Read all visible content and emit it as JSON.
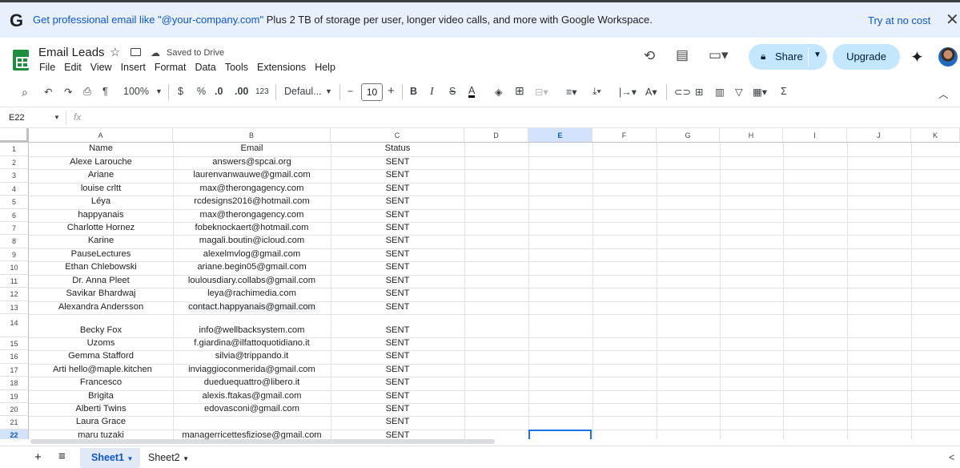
{
  "banner": {
    "logo": "G",
    "headline": "Get professional email like \"@your-company.com\"",
    "rest": " Plus 2 TB of storage per user, longer video calls, and more with Google Workspace.",
    "cta": "Try at no cost",
    "close": "✕"
  },
  "doc": {
    "title": "Email Leads",
    "saved": "Saved to Drive"
  },
  "menu": [
    "File",
    "Edit",
    "View",
    "Insert",
    "Format",
    "Data",
    "Tools",
    "Extensions",
    "Help"
  ],
  "header": {
    "share": "Share",
    "upgrade": "Upgrade"
  },
  "toolbar": {
    "zoom": "100%",
    "currency": "$",
    "percent": "%",
    "dec_dec": ".0",
    "dec_inc": ".00",
    "numfmt": "123",
    "font": "Defaul...",
    "font_size": "10",
    "bold": "B",
    "italic": "I",
    "strike": "S",
    "text_color": "A",
    "minus": "−",
    "plus": "+"
  },
  "formula": {
    "cell_ref": "E22",
    "fx": "fx",
    "value": ""
  },
  "columns": [
    "A",
    "B",
    "C",
    "D",
    "E",
    "F",
    "G",
    "H",
    "I",
    "J",
    "K"
  ],
  "selected_cell": "E22",
  "rows": [
    {
      "n": "1",
      "name": "Name",
      "email": "Email",
      "status": "Status"
    },
    {
      "n": "2",
      "name": "Alexe Larouche",
      "email": "answers@spcai.org",
      "status": "SENT"
    },
    {
      "n": "3",
      "name": "Ariane",
      "email": "laurenvanwauwe@gmail.com",
      "status": "SENT"
    },
    {
      "n": "4",
      "name": "louise crltt",
      "email": "max@therongagency.com",
      "status": "SENT"
    },
    {
      "n": "5",
      "name": "Léya",
      "email": "rcdesigns2016@hotmail.com",
      "status": "SENT"
    },
    {
      "n": "6",
      "name": "happyanais",
      "email": "max@therongagency.com",
      "status": "SENT"
    },
    {
      "n": "7",
      "name": "Charlotte Hornez",
      "email": "fobeknockaert@hotmail.com",
      "status": "SENT"
    },
    {
      "n": "8",
      "name": "Karine",
      "email": "magali.boutin@icloud.com",
      "status": "SENT"
    },
    {
      "n": "9",
      "name": "PauseLectures",
      "email": "alexelmvlog@gmail.com",
      "status": "SENT"
    },
    {
      "n": "10",
      "name": "Ethan Chlebowski",
      "email": "ariane.begin05@gmail.com",
      "status": "SENT"
    },
    {
      "n": "11",
      "name": "Dr. Anna Pleet",
      "email": "loulousdiary.collabs@gmail.com",
      "status": "SENT"
    },
    {
      "n": "12",
      "name": "Savikar Bhardwaj",
      "email": "leya@rachimedia.com",
      "status": "SENT"
    },
    {
      "n": "13",
      "name": "Alexandra Andersson",
      "email": "contact.happyanais@gmail.com",
      "status": "SENT"
    },
    {
      "n": "14",
      "name": "Becky Fox",
      "email": "info@wellbacksystem.com",
      "status": "SENT"
    },
    {
      "n": "15",
      "name": "Uzoms",
      "email": "f.giardina@ilfattoquotidiano.it",
      "status": "SENT"
    },
    {
      "n": "16",
      "name": "Gemma Stafford",
      "email": "silvia@trippando.it",
      "status": "SENT"
    },
    {
      "n": "17",
      "name": "Arti   hello@maple.kitchen",
      "email": "inviaggioconmerida@gmail.com",
      "status": "SENT"
    },
    {
      "n": "18",
      "name": "Francesco",
      "email": "dueduequattro@libero.it",
      "status": "SENT"
    },
    {
      "n": "19",
      "name": "Brigita",
      "email": "alexis.ftakas@gmail.com",
      "status": "SENT"
    },
    {
      "n": "20",
      "name": "Alberti Twins",
      "email": "edovasconi@gmail.com",
      "status": "SENT"
    },
    {
      "n": "21",
      "name": "Laura Grace",
      "email": "",
      "status": "SENT"
    },
    {
      "n": "22",
      "name": "maru tuzaki",
      "email": "managerricettesfiziose@gmail.com",
      "status": "SENT"
    }
  ],
  "sheets": [
    {
      "name": "Sheet1",
      "active": true
    },
    {
      "name": "Sheet2",
      "active": false
    }
  ],
  "icons": {
    "add_sheet": "+",
    "all_sheets": "≡",
    "collapse": "^",
    "left_arrow": "<"
  },
  "colors": {
    "accent": "#0b57d0",
    "banner_bg": "#e8f0fe",
    "share_bg": "#c2e7ff",
    "sheets_green": "#1e8e3e",
    "selection": "#1a73e8"
  }
}
